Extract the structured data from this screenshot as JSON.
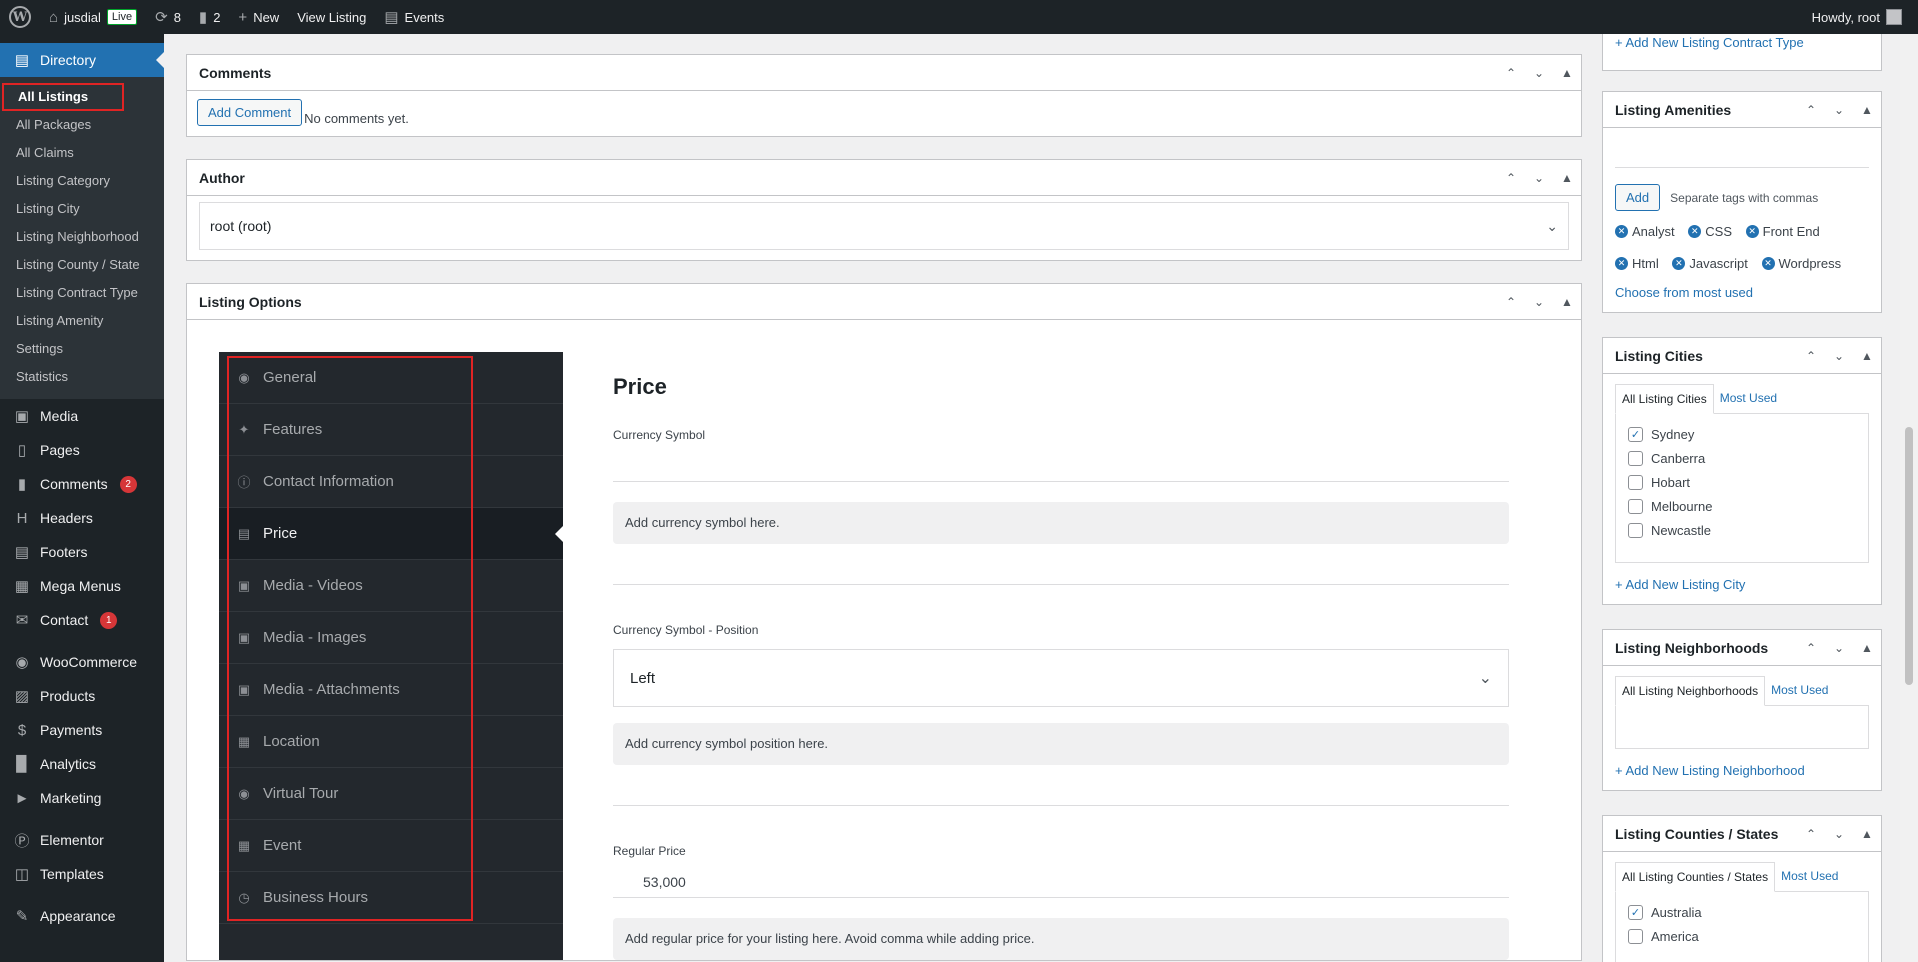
{
  "adminbar": {
    "site_name": "jusdial",
    "live_badge": "Live",
    "updates_count": "8",
    "comments_count": "2",
    "new_label": "New",
    "view_listing": "View Listing",
    "events": "Events",
    "howdy": "Howdy, root"
  },
  "menu": {
    "directory": "Directory",
    "sub": [
      "All Listings",
      "All Packages",
      "All Claims",
      "Listing Category",
      "Listing City",
      "Listing Neighborhood",
      "Listing County / State",
      "Listing Contract Type",
      "Listing Amenity",
      "Settings",
      "Statistics"
    ],
    "media": "Media",
    "pages": "Pages",
    "comments": "Comments",
    "comments_badge": "2",
    "headers": "Headers",
    "footers": "Footers",
    "mega_menus": "Mega Menus",
    "contact": "Contact",
    "contact_badge": "1",
    "woocommerce": "WooCommerce",
    "products": "Products",
    "payments": "Payments",
    "analytics": "Analytics",
    "marketing": "Marketing",
    "elementor": "Elementor",
    "templates": "Templates",
    "appearance": "Appearance"
  },
  "comments_box": {
    "title": "Comments",
    "add_button": "Add Comment",
    "empty": "No comments yet."
  },
  "author_box": {
    "title": "Author",
    "value": "root (root)"
  },
  "listing_options": {
    "title": "Listing Options",
    "nav": [
      "General",
      "Features",
      "Contact Information",
      "Price",
      "Media - Videos",
      "Media - Images",
      "Media - Attachments",
      "Location",
      "Virtual Tour",
      "Event",
      "Business Hours"
    ],
    "panel_title": "Price",
    "currency_symbol_label": "Currency Symbol",
    "currency_symbol_value": "",
    "currency_symbol_help": "Add currency symbol here.",
    "position_label": "Currency Symbol - Position",
    "position_value": "Left",
    "position_help": "Add currency symbol position here.",
    "regular_price_label": "Regular Price",
    "regular_price_value": "53,000",
    "regular_price_help": "Add regular price for your listing here. Avoid comma while adding price."
  },
  "sidebar": {
    "contract_link": "+ Add New Listing Contract Type",
    "amenities": {
      "title": "Listing Amenities",
      "add_button": "Add",
      "hint": "Separate tags with commas",
      "tags": [
        "Analyst",
        "CSS",
        "Front End",
        "Html",
        "Javascript",
        "Wordpress"
      ],
      "choose_link": "Choose from most used"
    },
    "cities": {
      "title": "Listing Cities",
      "tab_all": "All Listing Cities",
      "tab_most": "Most Used",
      "items": [
        "Sydney",
        "Canberra",
        "Hobart",
        "Melbourne",
        "Newcastle"
      ],
      "add_link": "+ Add New Listing City"
    },
    "neighborhoods": {
      "title": "Listing Neighborhoods",
      "tab_all": "All Listing Neighborhoods",
      "tab_most": "Most Used",
      "add_link": "+ Add New Listing Neighborhood"
    },
    "counties": {
      "title": "Listing Counties / States",
      "tab_all": "All Listing Counties / States",
      "tab_most": "Most Used",
      "items": [
        "Australia",
        "America"
      ]
    }
  }
}
